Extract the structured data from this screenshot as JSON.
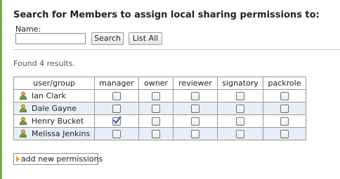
{
  "search": {
    "heading": "Search for Members to assign local sharing permissions to:",
    "name_label": "Name:",
    "name_value": "",
    "search_button": "Search",
    "list_all_button": "List All"
  },
  "results": {
    "found_text": "Found 4 results.",
    "columns": [
      "user/group",
      "manager",
      "owner",
      "reviewer",
      "signatory",
      "packrole"
    ],
    "rows": [
      {
        "name": "Ian Clark",
        "manager": false,
        "owner": false,
        "reviewer": false,
        "signatory": false,
        "packrole": false
      },
      {
        "name": "Dale Gayne",
        "manager": false,
        "owner": false,
        "reviewer": false,
        "signatory": false,
        "packrole": false
      },
      {
        "name": "Henry Bucket",
        "manager": true,
        "owner": false,
        "reviewer": false,
        "signatory": false,
        "packrole": false
      },
      {
        "name": "Melissa Jenkins",
        "manager": false,
        "owner": false,
        "reviewer": false,
        "signatory": false,
        "packrole": false
      }
    ]
  },
  "actions": {
    "add_permissions": "add new permissions"
  },
  "icons": {
    "user": "user-icon",
    "add": "arrow-icon"
  },
  "colors": {
    "accent_line": "#7fa847",
    "alt_row": "#e6eef7",
    "check": "#2a5db0"
  }
}
